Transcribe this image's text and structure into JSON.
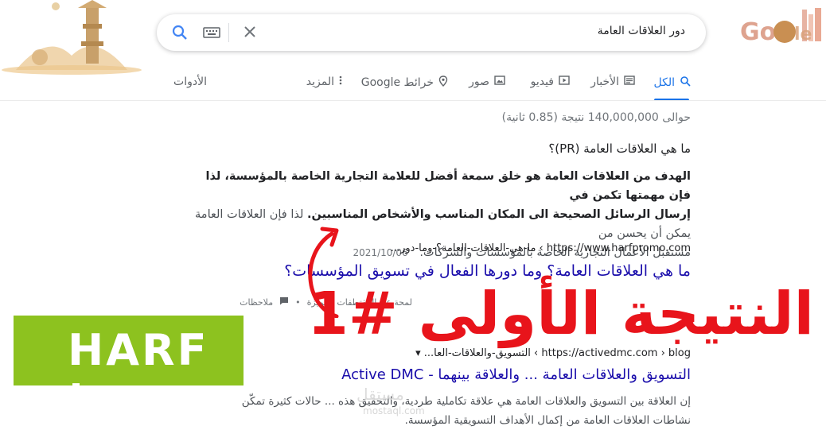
{
  "search": {
    "query": "دور العلاقات العامة",
    "brand_color": "#1a73e8"
  },
  "tabs": {
    "all": "الكل",
    "news": "الأخبار",
    "videos": "فيديو",
    "images": "صور",
    "maps": "خرائط Google",
    "more": "المزيد",
    "tools": "الأدوات"
  },
  "results": {
    "stats": "حوالى 140,000,000 نتيجة (0.85 ثانية)",
    "snippet": {
      "question": "ما هي العلاقات العامة (PR)؟",
      "bold_line1": "الهدف من العلاقات العامة هو خلق سمعة أفضل للعلامة التجارية الخاصة بالمؤسسة، لذا فإن مهمتها تكمن في",
      "bold_line2": "إرسال الرسائل الصحيحة الى المكان المناسب والأشخاص المناسبين.",
      "plain_line2": " لذا فإن العلاقات العامة يمكن أن يحسن من",
      "plain_line3": "مستقبل الأعمال التجارية الخاصة بالمؤسسات والشركات.",
      "date": "2021/10/06"
    },
    "first": {
      "url": "https://www.harfpromo.com › ما-هي-العلاقات-العامة؟-وما-دور...",
      "title": "ما هي العلاقات العامة؟ وما دورها الفعال في تسويق المؤسسات؟",
      "about": "لمحة عن المقتطفات المميّزة",
      "notes": "ملاحظات"
    },
    "second": {
      "url": "https://activedmc.com › blog › التسويق-والعلاقات-العا... ▾",
      "title": "التسويق والعلاقات العامة ... والعلاقة بينهما - Active DMC",
      "snippet_line1": "إن العلاقة بين التسويق والعلاقات العامة هي علاقة تكاملية طردية، والتحقيق هذه ... حالات كثيرة تمكّن",
      "snippet_line2": "نشاطات العلاقات العامة من إكمال الأهداف التسويقية المؤسسة."
    }
  },
  "overlay": {
    "brand": "HARF ’",
    "brand_color": "#8dc21f",
    "annotation": "النتيجة الأولى #1",
    "annotation_color": "#e8141b",
    "watermark": "مستقل",
    "watermark_sub": "mostaql.com"
  }
}
